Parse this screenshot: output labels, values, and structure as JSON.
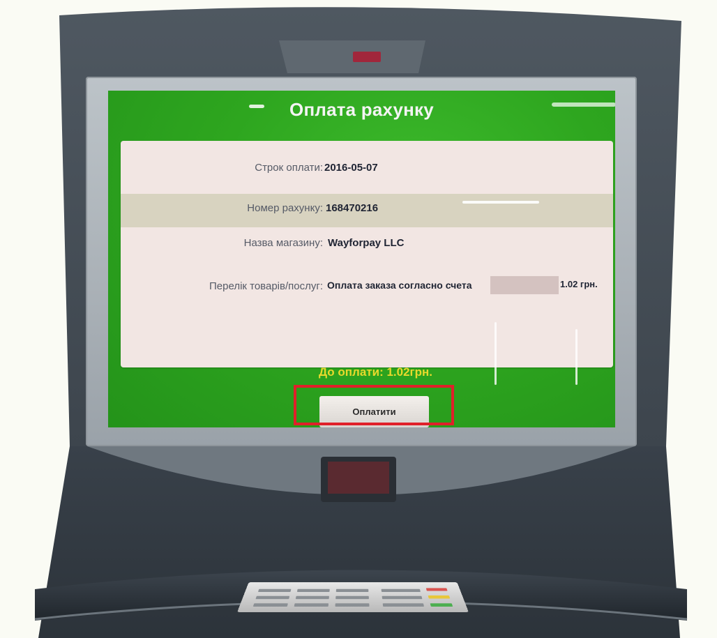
{
  "screen": {
    "title": "Оплата рахунку",
    "rows": [
      {
        "label": "Строк оплати:",
        "value": "2016-05-07"
      },
      {
        "label": "Номер рахунку:",
        "value": "168470216"
      },
      {
        "label": "Назва магазину:",
        "value": "Wayforpay LLC"
      },
      {
        "label": "Перелік товарів/послуг:",
        "value": "Оплата заказа согласно счета",
        "amount": "1.02 грн."
      }
    ],
    "amount_due": "До оплати: 1.02грн.",
    "pay_button": "Оплатити"
  },
  "colors": {
    "screen_green": "#2ea61f",
    "panel_bg": "#f2e6e3",
    "highlight_red": "#e0202a",
    "amount_yellow": "#e8d92c"
  }
}
